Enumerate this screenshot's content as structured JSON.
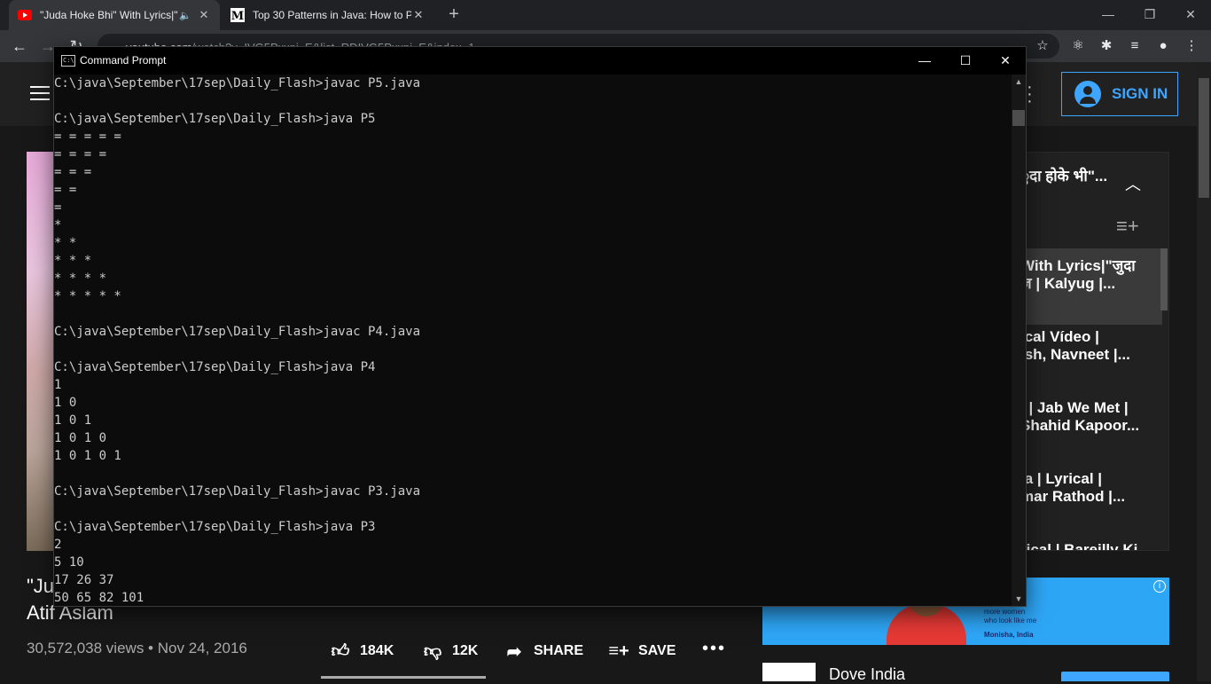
{
  "browser": {
    "tabs": [
      {
        "title": "\"Juda Hoke Bhi\" With Lyrics|\"",
        "favicon": "youtube-icon",
        "audio": true,
        "active": true
      },
      {
        "title": "Top 30 Patterns in Java: How to P",
        "favicon": "medium-icon",
        "active": false
      }
    ],
    "new_tab_symbol": "+",
    "url_domain": "youtube.com",
    "url_path": "/watch?v=IVG5Pxxpi_E&list=RDIVG5Pxxpi_E&index=1",
    "window_controls": {
      "minimize": "—",
      "restore": "❐",
      "close": "✕"
    }
  },
  "youtube": {
    "sign_in_label": "SIGN IN",
    "video_title_line1": "\"Ju",
    "video_title_line2": "Atif Aslam",
    "views": "30,572,038 views",
    "date": "Nov 24, 2016",
    "likes": "184K",
    "dislikes": "12K",
    "share_label": "SHARE",
    "save_label": "SAVE",
    "playlist": {
      "title": "ुदा होके भी\"...",
      "items": [
        {
          "line1": "With Lyrics|\"जुदा",
          "line2": "ज | Kalyug |..."
        },
        {
          "line1": "ical Vídeo |",
          "line2": "ish, Navneet |..."
        },
        {
          "line1": "l | Jab We Met |",
          "line2": "Shahid Kapoor..."
        },
        {
          "line1": "la | Lyrical |",
          "line2": "mar Rathod |..."
        },
        {
          "line1": "rical | Bareilly Ki",
          "line2": ""
        }
      ]
    },
    "ad": {
      "text_line1": "more women",
      "text_line2": "who look like me",
      "text_line3": "Monisha, India",
      "advertiser": "Dove India"
    }
  },
  "cmd": {
    "window_title": "Command Prompt",
    "icon_text": "C:\\",
    "lines": [
      "C:\\java\\September\\17sep\\Daily_Flash>javac P5.java",
      "",
      "C:\\java\\September\\17sep\\Daily_Flash>java P5",
      "= = = = =",
      "= = = =",
      "= = =",
      "= =",
      "=",
      "*",
      "* *",
      "* * *",
      "* * * *",
      "* * * * *",
      "",
      "C:\\java\\September\\17sep\\Daily_Flash>javac P4.java",
      "",
      "C:\\java\\September\\17sep\\Daily_Flash>java P4",
      "1",
      "1 0",
      "1 0 1",
      "1 0 1 0",
      "1 0 1 0 1",
      "",
      "C:\\java\\September\\17sep\\Daily_Flash>javac P3.java",
      "",
      "C:\\java\\September\\17sep\\Daily_Flash>java P3",
      "2",
      "5 10",
      "17 26 37",
      "50 65 82 101"
    ]
  }
}
